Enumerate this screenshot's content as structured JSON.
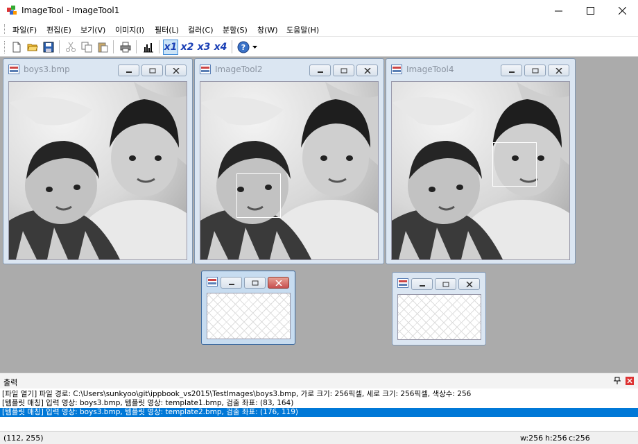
{
  "window": {
    "title": "ImageTool - ImageTool1",
    "minimize": "—",
    "maximize": "☐",
    "close": "✕"
  },
  "menu": [
    "파일(F)",
    "편집(E)",
    "보기(V)",
    "이미지(I)",
    "필터(L)",
    "컬러(C)",
    "분할(S)",
    "창(W)",
    "도움말(H)"
  ],
  "toolbar": {
    "zoom1": "x1",
    "zoom2": "x2",
    "zoom3": "x3",
    "zoom4": "x4",
    "help": "?"
  },
  "children": {
    "boys3": {
      "title": "boys3.bmp"
    },
    "tool2": {
      "title": "ImageTool2"
    },
    "tool4": {
      "title": "ImageTool4"
    }
  },
  "output": {
    "title": "출력",
    "lines": [
      "[파일 열기] 파일 경로: C:\\Users\\sunkyoo\\git\\ippbook_vs2015\\TestImages\\boys3.bmp, 가로 크기: 256픽셀, 세로 크기: 256픽셀, 색상수: 256",
      "[템플릿 매칭] 입력 영상: boys3.bmp, 템플릿 영상: template1.bmp, 검출 좌표: (83, 164)",
      "[템플릿 매칭] 입력 영상: boys3.bmp, 템플릿 영상: template2.bmp, 검출 좌표: (176, 119)"
    ],
    "pin": "ᵖ",
    "close": "×"
  },
  "status": {
    "coords": "(112, 255)",
    "width": "w:256",
    "height": "h:256",
    "colors": "c:256"
  },
  "colors": {
    "accent": "#0078d7",
    "mdi_bg": "#ababab",
    "child_frame": "#dbe6f2",
    "zoom_text": "#1a3fb5"
  }
}
